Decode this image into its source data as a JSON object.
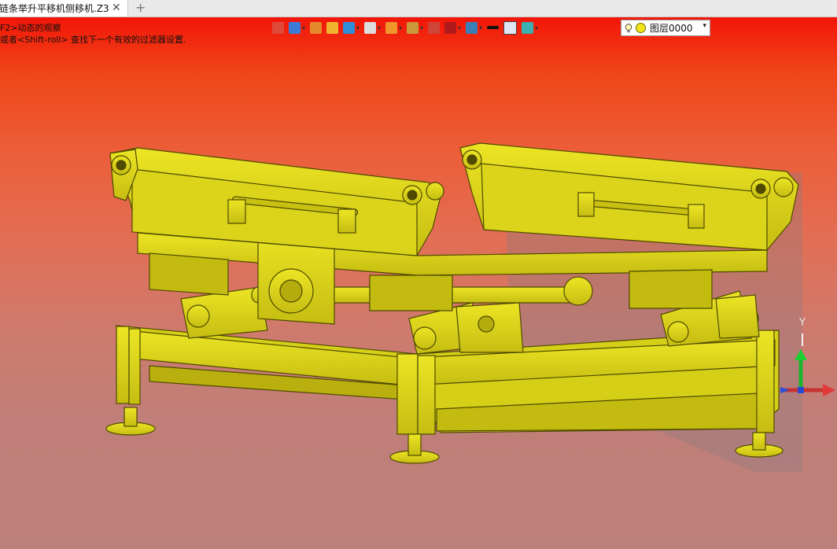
{
  "tab": {
    "title": "链条举升平移机侧移机.Z3",
    "close": "✕",
    "add": "+"
  },
  "hints": {
    "line1": "F2>动态的观察",
    "line2": "或者<Shift-roll> 查找下一个有效的过滤器设置."
  },
  "toolbar": {
    "items": [
      {
        "name": "exit-icon",
        "color": "#e04a3a",
        "dd": false
      },
      {
        "name": "print-icon",
        "color": "#3c7bd6",
        "dd": true
      },
      {
        "name": "pencil-icon",
        "color": "#e68a2e",
        "dd": false
      },
      {
        "name": "box-color-icon",
        "color": "#f0b431",
        "dd": false
      },
      {
        "name": "cube-shade-icon",
        "color": "#2e8fd8",
        "dd": true
      },
      {
        "name": "view-cube-icon",
        "color": "#dddddd",
        "dd": true
      },
      {
        "name": "render-icon",
        "color": "#f0962c",
        "dd": true
      },
      {
        "name": "zoom-icon",
        "color": "#c89a3a",
        "dd": true
      },
      {
        "name": "snap-icon",
        "color": "#d0453a",
        "dd": false
      },
      {
        "name": "frame-icon",
        "color": "#b01a1a",
        "dd": true
      },
      {
        "name": "display-icon",
        "color": "#3a7fb8",
        "dd": true
      },
      {
        "name": "line-style-icon",
        "color": "#111111",
        "dd": false
      },
      {
        "name": "color-swatch-icon",
        "color": "#dfe6f2",
        "dd": false
      },
      {
        "name": "layer-manager-icon",
        "color": "#3ab0b0",
        "dd": true
      }
    ]
  },
  "layer": {
    "label": "图层0000",
    "arrow": "▾"
  },
  "colors": {
    "model": "#e4dc1a",
    "dark": "#7c7600",
    "bg_top": "#f21508",
    "bg_bottom": "#bb8079"
  }
}
